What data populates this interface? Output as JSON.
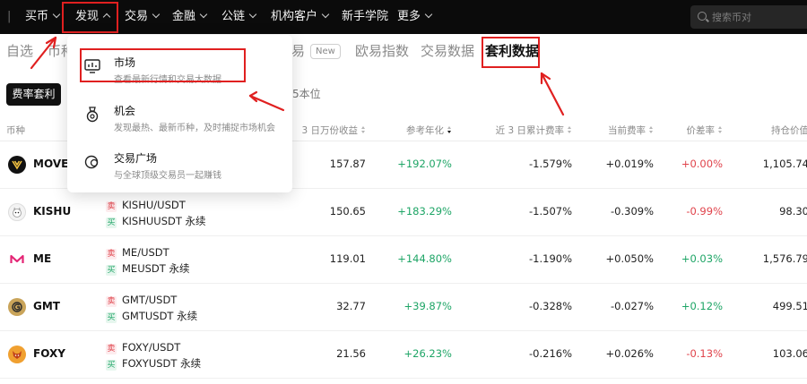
{
  "nav": {
    "items": [
      {
        "label": "买币",
        "chevron": "down"
      },
      {
        "label": "发现",
        "chevron": "up"
      },
      {
        "label": "交易",
        "chevron": "down"
      },
      {
        "label": "金融",
        "chevron": "down"
      },
      {
        "label": "公链",
        "chevron": "down"
      },
      {
        "label": "机构客户",
        "chevron": "down"
      },
      {
        "label": "新手学院",
        "chevron": ""
      },
      {
        "label": "更多",
        "chevron": "down"
      }
    ],
    "search_placeholder": "搜索币对"
  },
  "subtabs": {
    "items": [
      "自选",
      "币种",
      "交易",
      "欧易指数",
      "交易数据",
      "套利数据"
    ],
    "new_badge": "New",
    "active": "套利数据"
  },
  "filter": {
    "button": "费率套利",
    "unit_text": "5本位"
  },
  "table": {
    "headers": [
      "币种",
      "3 日万份收益",
      "参考年化",
      "近 3 日累计费率",
      "当前费率",
      "价差率",
      "持仓价值"
    ],
    "sell_tag": "卖",
    "buy_tag": "买",
    "rows": [
      {
        "coin": "MOVE",
        "spot": "",
        "perp": "",
        "yield": "157.87",
        "apy": "+192.07%",
        "cum": "-1.579%",
        "rate": "+0.019%",
        "diff": "+0.00%",
        "diff_color": "red",
        "value": "1,105.74"
      },
      {
        "coin": "KISHU",
        "spot": "KISHU/USDT",
        "perp": "KISHUUSDT 永续",
        "yield": "150.65",
        "apy": "+183.29%",
        "cum": "-1.507%",
        "rate": "-0.309%",
        "diff": "-0.99%",
        "diff_color": "red",
        "value": "98.30"
      },
      {
        "coin": "ME",
        "spot": "ME/USDT",
        "perp": "MEUSDT 永续",
        "yield": "119.01",
        "apy": "+144.80%",
        "cum": "-1.190%",
        "rate": "+0.050%",
        "diff": "+0.03%",
        "diff_color": "green",
        "value": "1,576.79"
      },
      {
        "coin": "GMT",
        "spot": "GMT/USDT",
        "perp": "GMTUSDT 永续",
        "yield": "32.77",
        "apy": "+39.87%",
        "cum": "-0.328%",
        "rate": "-0.027%",
        "diff": "+0.12%",
        "diff_color": "green",
        "value": "499.51"
      },
      {
        "coin": "FOXY",
        "spot": "FOXY/USDT",
        "perp": "FOXYUSDT 永续",
        "yield": "21.56",
        "apy": "+26.23%",
        "cum": "-0.216%",
        "rate": "+0.026%",
        "diff": "-0.13%",
        "diff_color": "red",
        "value": "103.06"
      }
    ]
  },
  "dropdown": {
    "items": [
      {
        "title": "市场",
        "desc": "查看最新行情和交易大数据",
        "icon": "chart-monitor-icon"
      },
      {
        "title": "机会",
        "desc": "发现最热、最新币种，及时捕捉市场机会",
        "icon": "medal-icon"
      },
      {
        "title": "交易广场",
        "desc": "与全球顶级交易员一起赚钱",
        "icon": "chat-bubbles-icon"
      }
    ]
  },
  "colors": {
    "nav_bg": "#0b0b0b",
    "annotation_red": "#e02020",
    "up_green": "#1ea566",
    "down_red": "#e0434b"
  }
}
